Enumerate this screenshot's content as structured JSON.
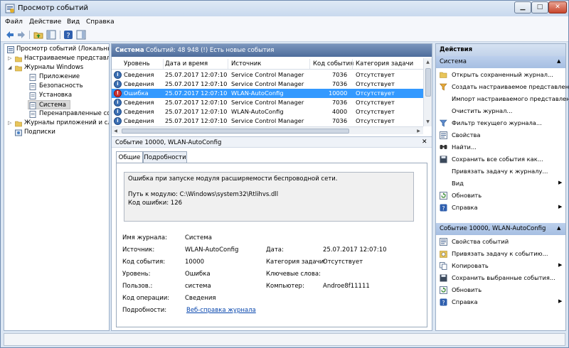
{
  "window": {
    "title": "Просмотр событий"
  },
  "menu": [
    "Файл",
    "Действие",
    "Вид",
    "Справка"
  ],
  "tree": {
    "items": [
      {
        "label": "Просмотр событий (Локальный)",
        "icon": "event-viewer-icon"
      },
      {
        "label": "Настраиваемые представления",
        "icon": "folder-icon"
      },
      {
        "label": "Журналы Windows",
        "icon": "folder-icon"
      },
      {
        "label": "Приложение",
        "icon": "log-icon"
      },
      {
        "label": "Безопасность",
        "icon": "log-icon"
      },
      {
        "label": "Установка",
        "icon": "log-icon"
      },
      {
        "label": "Система",
        "icon": "log-icon"
      },
      {
        "label": "Перенаправленные события",
        "icon": "log-icon"
      },
      {
        "label": "Журналы приложений и служб",
        "icon": "folder-icon"
      },
      {
        "label": "Подписки",
        "icon": "subscriptions-icon"
      }
    ]
  },
  "center": {
    "header_title": "Система",
    "header_info": "Событий: 48 948 (!) Есть новые события",
    "columns": [
      "Уровень",
      "Дата и время",
      "Источник",
      "Код события",
      "Категория задачи"
    ],
    "rows": [
      {
        "level": "Сведения",
        "date": "25.07.2017 12:07:10",
        "source": "Service Control Manager",
        "code": "7036",
        "category": "Отсутствует"
      },
      {
        "level": "Сведения",
        "date": "25.07.2017 12:07:10",
        "source": "Service Control Manager",
        "code": "7036",
        "category": "Отсутствует"
      },
      {
        "level": "Ошибка",
        "date": "25.07.2017 12:07:10",
        "source": "WLAN-AutoConfig",
        "code": "10000",
        "category": "Отсутствует"
      },
      {
        "level": "Сведения",
        "date": "25.07.2017 12:07:10",
        "source": "Service Control Manager",
        "code": "7036",
        "category": "Отсутствует"
      },
      {
        "level": "Сведения",
        "date": "25.07.2017 12:07:10",
        "source": "WLAN-AutoConfig",
        "code": "4000",
        "category": "Отсутствует"
      },
      {
        "level": "Сведения",
        "date": "25.07.2017 12:07:10",
        "source": "Service Control Manager",
        "code": "7036",
        "category": "Отсутствует"
      }
    ],
    "selected_row": 2
  },
  "detail": {
    "title": "Событие 10000, WLAN-AutoConfig",
    "tabs": [
      "Общие",
      "Подробности"
    ],
    "message_lines": [
      "Ошибка при запуске модуля расширяемости беспроводной сети.",
      "Путь к модулю: C:\\Windows\\system32\\Rtlihvs.dll",
      "Код ошибки: 126"
    ],
    "fields": {
      "log_name_label": "Имя журнала:",
      "log_name": "Система",
      "source_label": "Источник:",
      "source": "WLAN-AutoConfig",
      "date_label": "Дата:",
      "date": "25.07.2017 12:07:10",
      "event_id_label": "Код события:",
      "event_id": "10000",
      "task_label": "Категория задачи:",
      "task": "Отсутствует",
      "level_label": "Уровень:",
      "level": "Ошибка",
      "keywords_label": "Ключевые слова:",
      "user_label": "Пользов.:",
      "user": "система",
      "computer_label": "Компьютер:",
      "computer": "Androe8f11111",
      "opcode_label": "Код операции:",
      "opcode": "Сведения",
      "more_label": "Подробности:",
      "more_link": "Веб-справка журнала"
    }
  },
  "actions": {
    "header": "Действия",
    "section1": "Система",
    "items1": [
      {
        "label": "Открыть сохраненный журнал...",
        "icon": "open-folder-icon"
      },
      {
        "label": "Создать настраиваемое представление...",
        "icon": "filter-create-icon"
      },
      {
        "label": "Импорт настраиваемого представления...",
        "icon": ""
      },
      {
        "label": "Очистить журнал...",
        "icon": ""
      },
      {
        "label": "Фильтр текущего журнала...",
        "icon": "filter-icon"
      },
      {
        "label": "Свойства",
        "icon": "properties-icon"
      },
      {
        "label": "Найти...",
        "icon": "find-icon"
      },
      {
        "label": "Сохранить все события как...",
        "icon": "save-icon"
      },
      {
        "label": "Привязать задачу к журналу...",
        "icon": ""
      },
      {
        "label": "Вид",
        "icon": "",
        "submenu": true
      },
      {
        "label": "Обновить",
        "icon": "refresh-icon"
      },
      {
        "label": "Справка",
        "icon": "help-icon",
        "submenu": true
      }
    ],
    "section2": "Событие 10000, WLAN-AutoConfig",
    "items2": [
      {
        "label": "Свойства событий",
        "icon": "properties-icon"
      },
      {
        "label": "Привязать задачу к событию...",
        "icon": "task-icon"
      },
      {
        "label": "Копировать",
        "icon": "copy-icon",
        "submenu": true
      },
      {
        "label": "Сохранить выбранные события...",
        "icon": "save-icon"
      },
      {
        "label": "Обновить",
        "icon": "refresh-icon"
      },
      {
        "label": "Справка",
        "icon": "help-icon",
        "submenu": true
      }
    ]
  }
}
